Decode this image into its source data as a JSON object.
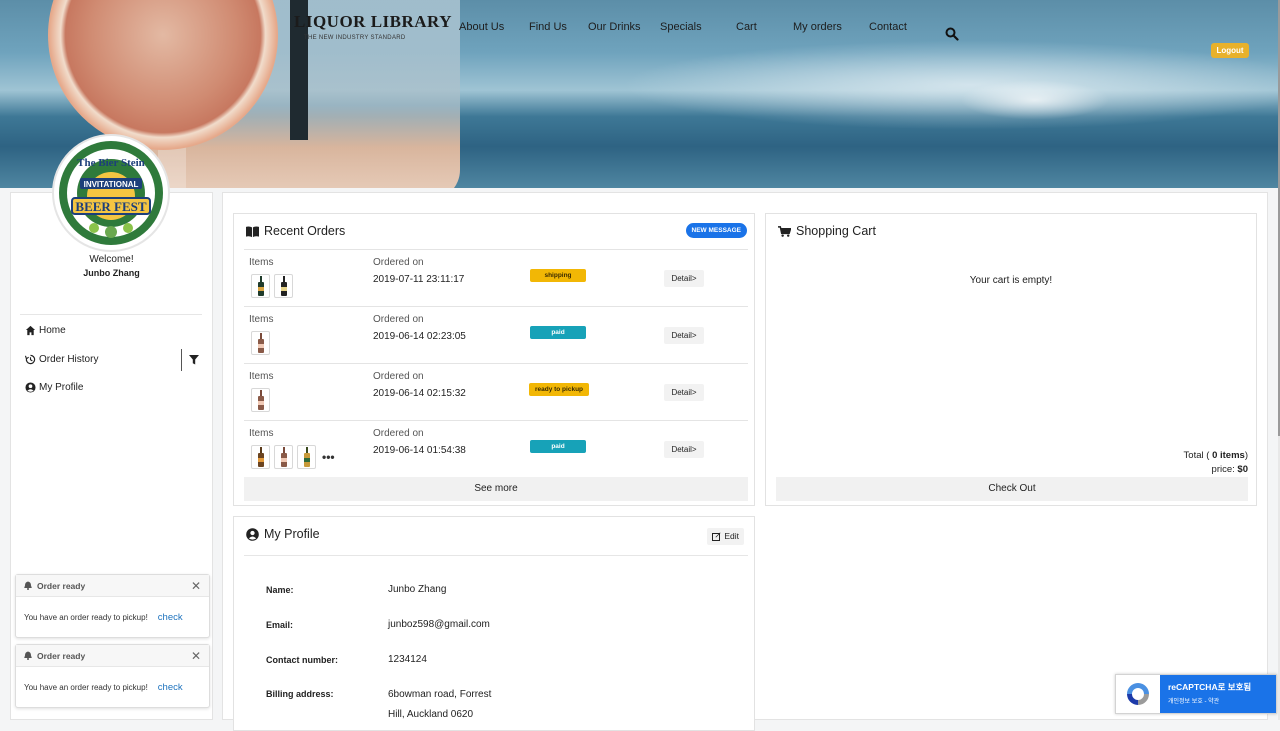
{
  "brand": {
    "name": "LIQUOR LIBRARY",
    "tagline": "THE NEW INDUSTRY STANDARD"
  },
  "nav": {
    "items": [
      {
        "label": "About Us"
      },
      {
        "label": "Find Us"
      },
      {
        "label": "Our Drinks"
      },
      {
        "label": "Specials"
      },
      {
        "label": "Cart"
      },
      {
        "label": "My orders"
      },
      {
        "label": "Contact"
      }
    ],
    "search_icon": "search-icon",
    "logout_label": "Logout"
  },
  "sidebar": {
    "logo_text": {
      "line1": "The Bier Stein",
      "line2": "INVITATIONAL",
      "line3": "BEER FEST"
    },
    "welcome": "Welcome!",
    "user_name": "Junbo Zhang",
    "menu": [
      {
        "label": "Home",
        "icon": "home-icon"
      },
      {
        "label": "Order History",
        "icon": "history-icon"
      },
      {
        "label": "My Profile",
        "icon": "user-circle-icon"
      }
    ],
    "filter_icon": "filter-icon"
  },
  "notifications": [
    {
      "title": "Order ready",
      "message": "You have an order ready to pickup!",
      "action": "check"
    },
    {
      "title": "Order ready",
      "message": "You have an order ready to pickup!",
      "action": "check"
    }
  ],
  "recent_orders": {
    "title": "Recent Orders",
    "new_message_badge": "NEW MESSAGE",
    "items_label": "Items",
    "ordered_on_label": "Ordered on",
    "detail_label": "Detail>",
    "see_more": "See more",
    "orders": [
      {
        "date": "2019-07-11 23:11:17",
        "status": "shipping",
        "status_color": "#f2b705"
      },
      {
        "date": "2019-06-14 02:23:05",
        "status": "paid",
        "status_color": "#17a2b8"
      },
      {
        "date": "2019-06-14 02:15:32",
        "status": "ready to pickup",
        "status_color": "#f2b705"
      },
      {
        "date": "2019-06-14 01:54:38",
        "status": "paid",
        "status_color": "#17a2b8",
        "more_indicator": "•••"
      }
    ]
  },
  "shopping_cart": {
    "title": "Shopping Cart",
    "empty_message": "Your cart is empty!",
    "total_label": "Total",
    "total_items": "0 items",
    "price_label": "price:",
    "price_value": "$0",
    "checkout_label": "Check Out"
  },
  "profile": {
    "title": "My Profile",
    "edit_label": "Edit",
    "fields": [
      {
        "label": "Name:",
        "value": "Junbo Zhang"
      },
      {
        "label": "Email:",
        "value": "junboz598@gmail.com"
      },
      {
        "label": "Contact number:",
        "value": "1234124"
      },
      {
        "label": "Billing address:",
        "value": "6bowman road, Forrest",
        "value2": "Hill, Auckland 0620"
      }
    ]
  },
  "recaptcha": {
    "line1": "reCAPTCHA로 보호됨",
    "line2": "개인정보 보호 - 약관"
  },
  "colors": {
    "accent": "#1a73e8",
    "logout": "#e8b12b",
    "shipping": "#f2b705",
    "paid": "#17a2b8"
  }
}
